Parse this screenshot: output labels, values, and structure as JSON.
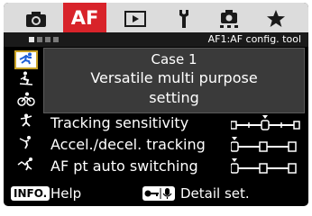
{
  "tabs": [
    {
      "icon": "camera-icon"
    },
    {
      "label": "AF",
      "icon": "af-icon"
    },
    {
      "icon": "playback-icon"
    },
    {
      "icon": "wrench-icon"
    },
    {
      "icon": "custom-function-icon"
    },
    {
      "icon": "my-menu-star-icon"
    }
  ],
  "active_tab": "AF",
  "menu_title": "AF1:AF config. tool",
  "page_dots": {
    "total": 4,
    "current": 1
  },
  "cases": [
    {
      "icon": "runner-icon",
      "selected": true
    },
    {
      "icon": "skier-icon",
      "selected": false
    },
    {
      "icon": "cyclist-icon",
      "selected": false
    },
    {
      "icon": "gymnast-icon",
      "selected": false
    },
    {
      "icon": "figure-skater-icon",
      "selected": false
    },
    {
      "icon": "dancer-icon",
      "selected": false
    }
  ],
  "panel": {
    "case_number": "Case 1",
    "description_line1": "Versatile multi purpose",
    "description_line2": "setting"
  },
  "parameters": [
    {
      "label": "Tracking sensitivity",
      "value": 0
    },
    {
      "label": "Accel./decel. tracking",
      "value": 0
    },
    {
      "label": "AF pt auto switching",
      "value": 0
    }
  ],
  "footer": {
    "info_label": "INFO.",
    "help_label": "Help",
    "detail_label": "Detail set."
  },
  "colors": {
    "accent": "#d8232a",
    "selection": "#c9a227",
    "panel": "#3a3a3a"
  }
}
